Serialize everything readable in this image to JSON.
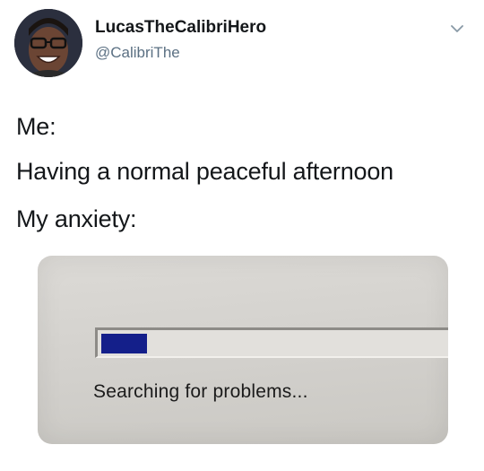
{
  "author": {
    "display_name": "LucasTheCalibriHero",
    "handle": "@CalibriThe",
    "avatar_icon": "profile-photo"
  },
  "menu": {
    "icon": "chevron-down-icon"
  },
  "tweet": {
    "lines": [
      "Me:",
      "Having a normal peaceful afternoon",
      "My anxiety:"
    ]
  },
  "media": {
    "progress_fraction": 0.12,
    "progress_color": "#141f8a",
    "status_text": "Searching for problems..."
  },
  "colors": {
    "handle": "#5b7083",
    "text": "#14171a"
  }
}
